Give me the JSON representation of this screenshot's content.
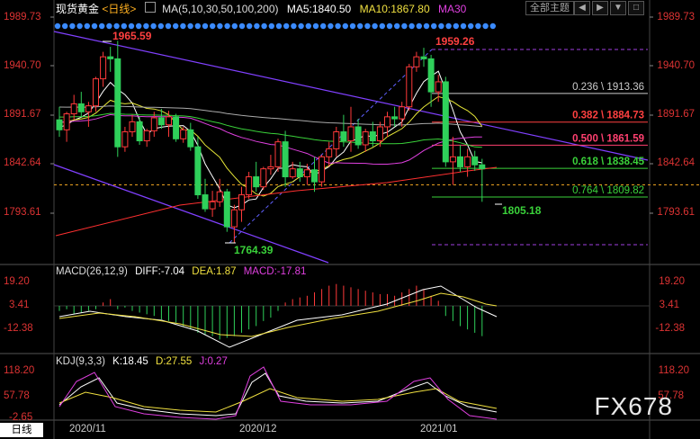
{
  "header": {
    "title": "现货黄金",
    "period": "<日线>",
    "ma_label": "MA(5,10,30,50,100,200)",
    "ma5": "MA5:1840.50",
    "ma10": "MA10:1867.80",
    "ma30": "MA30",
    "theme": "全部主题",
    "btn_prev": "◀",
    "btn_next": "▶",
    "btn_menu": "▼"
  },
  "colors": {
    "up": "#ff3a3a",
    "down": "#2fd05a",
    "ma5": "#ffffff",
    "ma10": "#e8e838",
    "ma30": "#e040e0",
    "ma50": "#3ad23a",
    "ma100": "#aaaaaa",
    "ma200": "#ff3030",
    "channel": "#8040ff",
    "fib": "#ff3030",
    "accent_blue": "#3b8bff"
  },
  "price_axis": {
    "ticks": [
      "1989.73",
      "1940.70",
      "1891.67",
      "1842.64",
      "1793.61"
    ],
    "range": [
      1765,
      2000
    ]
  },
  "annotations": {
    "high_label": "1965.59",
    "low_label": "1764.39",
    "peak_label": "1959.26",
    "last_low_label": "1805.18"
  },
  "fib_levels": [
    {
      "label": "0.236 \\ 1913.36",
      "value": 1913.36,
      "color": "#cccccc"
    },
    {
      "label": "0.382 \\ 1884.73",
      "value": 1884.73,
      "color": "#ff4040"
    },
    {
      "label": "0.500 \\ 1861.59",
      "value": 1861.59,
      "color": "#ff4070"
    },
    {
      "label": "0.618 \\ 1838.45",
      "value": 1838.45,
      "color": "#3ad23a"
    },
    {
      "label": "0.764 \\ 1809.82",
      "value": 1809.82,
      "color": "#3ad23a"
    }
  ],
  "macd": {
    "label": "MACD(26,12,9)",
    "diff": "DIFF:-7.04",
    "dea": "DEA:1.87",
    "macd": "MACD:-17.81",
    "ticks": [
      "19.20",
      "3.41",
      "-12.38"
    ]
  },
  "kdj": {
    "label": "KDJ(9,3,3)",
    "k": "K:18.45",
    "d": "D:27.55",
    "j": "J:0.27",
    "ticks": [
      "118.20",
      "57.78",
      "-2.65"
    ]
  },
  "x_axis": {
    "period_tag": "日线",
    "labels": [
      "2020/11",
      "2020/12",
      "2021/01"
    ]
  },
  "watermark": "FX678",
  "chart_data": {
    "type": "candlestick",
    "title": "现货黄金 <日线>",
    "candles": [
      [
        1887,
        1900,
        1870,
        1877
      ],
      [
        1877,
        1895,
        1865,
        1893
      ],
      [
        1893,
        1912,
        1887,
        1903
      ],
      [
        1903,
        1915,
        1890,
        1895
      ],
      [
        1895,
        1905,
        1880,
        1901
      ],
      [
        1901,
        1930,
        1895,
        1928
      ],
      [
        1928,
        1955,
        1920,
        1950
      ],
      [
        1950,
        1960,
        1935,
        1948
      ],
      [
        1948,
        1966,
        1850,
        1860
      ],
      [
        1860,
        1880,
        1855,
        1875
      ],
      [
        1875,
        1892,
        1870,
        1885
      ],
      [
        1885,
        1890,
        1862,
        1866
      ],
      [
        1866,
        1878,
        1860,
        1876
      ],
      [
        1876,
        1895,
        1870,
        1889
      ],
      [
        1889,
        1898,
        1878,
        1882
      ],
      [
        1882,
        1896,
        1870,
        1890
      ],
      [
        1890,
        1893,
        1865,
        1868
      ],
      [
        1868,
        1880,
        1864,
        1877
      ],
      [
        1877,
        1884,
        1856,
        1860
      ],
      [
        1860,
        1870,
        1808,
        1812
      ],
      [
        1812,
        1828,
        1795,
        1798
      ],
      [
        1798,
        1816,
        1790,
        1805
      ],
      [
        1805,
        1828,
        1800,
        1815
      ],
      [
        1815,
        1818,
        1775,
        1780
      ],
      [
        1780,
        1802,
        1764,
        1797
      ],
      [
        1797,
        1820,
        1785,
        1812
      ],
      [
        1812,
        1835,
        1808,
        1830
      ],
      [
        1830,
        1845,
        1815,
        1820
      ],
      [
        1820,
        1840,
        1817,
        1838
      ],
      [
        1838,
        1852,
        1832,
        1840
      ],
      [
        1840,
        1868,
        1835,
        1865
      ],
      [
        1865,
        1876,
        1820,
        1830
      ],
      [
        1830,
        1845,
        1828,
        1838
      ],
      [
        1838,
        1845,
        1825,
        1830
      ],
      [
        1830,
        1843,
        1822,
        1837
      ],
      [
        1837,
        1850,
        1815,
        1825
      ],
      [
        1825,
        1852,
        1820,
        1850
      ],
      [
        1850,
        1865,
        1840,
        1858
      ],
      [
        1858,
        1880,
        1850,
        1875
      ],
      [
        1875,
        1892,
        1860,
        1866
      ],
      [
        1866,
        1900,
        1855,
        1880
      ],
      [
        1880,
        1888,
        1858,
        1862
      ],
      [
        1862,
        1878,
        1855,
        1875
      ],
      [
        1875,
        1885,
        1860,
        1866
      ],
      [
        1866,
        1885,
        1860,
        1880
      ],
      [
        1880,
        1895,
        1870,
        1890
      ],
      [
        1890,
        1900,
        1880,
        1888
      ],
      [
        1888,
        1905,
        1880,
        1900
      ],
      [
        1900,
        1943,
        1896,
        1940
      ],
      [
        1940,
        1955,
        1935,
        1950
      ],
      [
        1950,
        1959,
        1940,
        1948
      ],
      [
        1948,
        1952,
        1900,
        1915
      ],
      [
        1915,
        1932,
        1905,
        1925
      ],
      [
        1925,
        1930,
        1840,
        1845
      ],
      [
        1845,
        1870,
        1822,
        1850
      ],
      [
        1850,
        1862,
        1835,
        1840
      ],
      [
        1840,
        1858,
        1830,
        1850
      ],
      [
        1850,
        1856,
        1836,
        1842
      ],
      [
        1842,
        1848,
        1805,
        1838
      ]
    ]
  }
}
